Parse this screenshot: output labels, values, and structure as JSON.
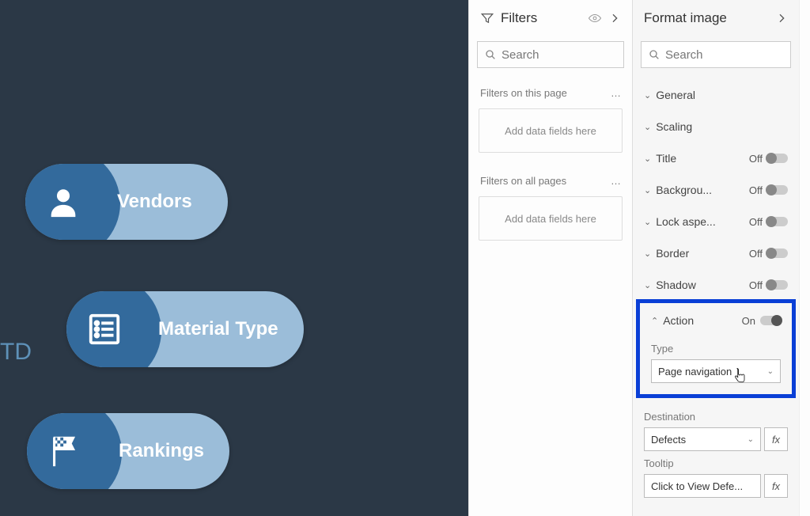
{
  "canvas": {
    "partial_text": "TD",
    "buttons": [
      {
        "label": "Vendors"
      },
      {
        "label": "Material Type"
      },
      {
        "label": "Rankings"
      }
    ]
  },
  "filters": {
    "title": "Filters",
    "search_placeholder": "Search",
    "sections": [
      {
        "title": "Filters on this page",
        "drop_hint": "Add data fields here"
      },
      {
        "title": "Filters on all pages",
        "drop_hint": "Add data fields here"
      }
    ]
  },
  "format": {
    "title": "Format image",
    "search_placeholder": "Search",
    "rows": {
      "general": {
        "label": "General"
      },
      "scaling": {
        "label": "Scaling"
      },
      "title": {
        "label": "Title",
        "state": "Off"
      },
      "backgrou": {
        "label": "Backgrou...",
        "state": "Off"
      },
      "lockaspe": {
        "label": "Lock aspe...",
        "state": "Off"
      },
      "border": {
        "label": "Border",
        "state": "Off"
      },
      "shadow": {
        "label": "Shadow",
        "state": "Off"
      },
      "action": {
        "label": "Action",
        "state": "On"
      }
    },
    "type_label": "Type",
    "type_value": "Page navigation",
    "destination_label": "Destination",
    "destination_value": "Defects",
    "tooltip_label": "Tooltip",
    "tooltip_value": "Click to View Defe...",
    "fx": "fx"
  }
}
